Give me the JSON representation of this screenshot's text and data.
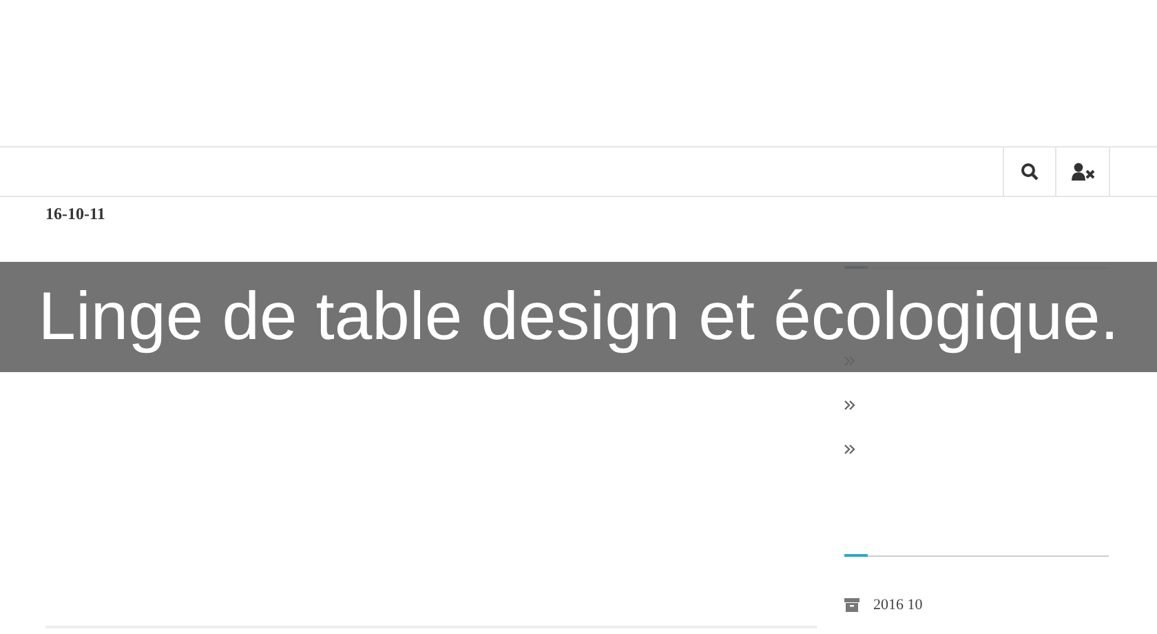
{
  "nav": {
    "buttons": [
      {
        "kind": "search"
      },
      {
        "kind": "user-x"
      }
    ]
  },
  "post": {
    "date": "16-10-11"
  },
  "sidebar": {
    "archive": [
      {
        "label": "2016 10"
      }
    ]
  },
  "banner": {
    "title": "Linge de table design et écologique."
  }
}
